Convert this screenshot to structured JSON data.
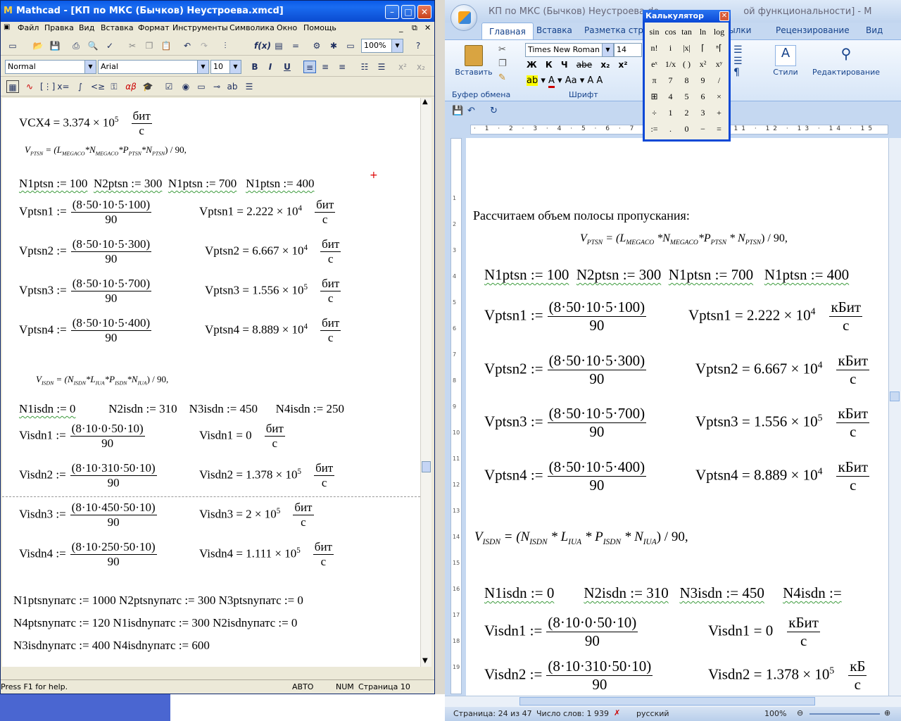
{
  "word": {
    "title": "КП по МКС (Бычков) Неустроева.do",
    "title_suffix": "ой функциональности] - M",
    "tabs": [
      "Главная",
      "Вставка",
      "Разметка стран",
      "ссылки",
      "Рецензирование",
      "Вид"
    ],
    "ribbon": {
      "paste": "Вставить",
      "clipboard_group": "Буфер обмена",
      "font_name": "Times New Roman",
      "font_size": "14",
      "font_group": "Шрифт",
      "styles": "Стили",
      "editing": "Редактирование",
      "format_buttons": [
        "Ж",
        "К",
        "Ч",
        "abe",
        "x₂",
        "x²",
        "Aa"
      ]
    },
    "ruler_marks": "· 1 · 2 · 3 · 4 · 5 · 6 · 7 · 8 · 9 · 10 · 11 · 12 · 13 · 14 · 15",
    "vruler_marks": [
      "1",
      "2",
      "3",
      "4",
      "5",
      "6",
      "7",
      "8",
      "9",
      "10",
      "11",
      "12",
      "13",
      "14",
      "15",
      "16",
      "17",
      "18",
      "19"
    ],
    "doc": {
      "intro": "Рассчитаем объем полосы пропускания:",
      "formula_ptsn": "= (L*N*P*N) / 90,",
      "formula_ptsn_parts": {
        "lhs": "V",
        "lhs_sub": "PTSN",
        "a": "L",
        "a_sub": "MEGACO",
        "b": "N",
        "b_sub": "MEGACO",
        "c": "P",
        "c_sub": "PTSN",
        "d": "N",
        "d_sub": "PTSN",
        "tail": ") / 90,"
      },
      "assign_ptsn": [
        "N1ptsn := 100",
        "N2ptsn := 300",
        "N1ptsn := 700",
        "N1ptsn := 400"
      ],
      "rows_ptsn": [
        {
          "lhs": "Vptsn1 :=",
          "num": "(8·50·10·5·100)",
          "den": "90",
          "res": "Vptsn1 = 2.222 × 10",
          "exp": "4",
          "unit_n": "кБит",
          "unit_d": "с"
        },
        {
          "lhs": "Vptsn2 :=",
          "num": "(8·50·10·5·300)",
          "den": "90",
          "res": "Vptsn2 = 6.667 × 10",
          "exp": "4",
          "unit_n": "кБит",
          "unit_d": "с"
        },
        {
          "lhs": "Vptsn3 :=",
          "num": "(8·50·10·5·700)",
          "den": "90",
          "res": "Vptsn3 = 1.556 × 10",
          "exp": "5",
          "unit_n": "кБит",
          "unit_d": "с"
        },
        {
          "lhs": "Vptsn4 :=",
          "num": "(8·50·10·5·400)",
          "den": "90",
          "res": "Vptsn4 = 8.889 × 10",
          "exp": "4",
          "unit_n": "кБит",
          "unit_d": "с"
        }
      ],
      "formula_isdn": {
        "lhs": "V",
        "lhs_sub": "ISDN",
        "a": "N",
        "a_sub": "ISDN",
        "b": "L",
        "b_sub": "IUA",
        "c": "P",
        "c_sub": "ISDN",
        "d": "N",
        "d_sub": "IUA",
        "tail": ") / 90,"
      },
      "assign_isdn": [
        "N1isdn := 0",
        "N2isdn := 310",
        "N3isdn := 450",
        "N4isdn :="
      ],
      "rows_isdn": [
        {
          "lhs": "Visdn1 :=",
          "num": "(8·10·0·50·10)",
          "den": "90",
          "res": "Visdn1 = 0",
          "exp": "",
          "unit_n": "кБит",
          "unit_d": "с"
        },
        {
          "lhs": "Visdn2 :=",
          "num": "(8·10·310·50·10)",
          "den": "90",
          "res": "Visdn2 = 1.378 × 10",
          "exp": "5",
          "unit_n": "кБ",
          "unit_d": "с"
        }
      ]
    },
    "status": {
      "page": "Страница: 24 из 47",
      "words": "Число слов: 1 939",
      "lang": "русский",
      "zoom": "100%"
    }
  },
  "calculator": {
    "title": "Калькулятор",
    "keys": [
      "sin",
      "cos",
      "tan",
      "ln",
      "log",
      "n!",
      "i",
      "|x|",
      "⌈",
      "ⁿ⌈",
      "eˣ",
      "1/x",
      "( )",
      "x²",
      "xʸ",
      "π",
      "7",
      "8",
      "9",
      "/",
      "⊞",
      "4",
      "5",
      "6",
      "×",
      "÷",
      "1",
      "2",
      "3",
      "+",
      ":=",
      ".",
      "0",
      "−",
      "="
    ]
  },
  "mathcad": {
    "title": "Mathcad - [КП по МКС (Бычков) Неустроева.xmcd]",
    "menu": [
      "Файл",
      "Правка",
      "Вид",
      "Вставка",
      "Формат",
      "Инструменты",
      "Символика",
      "Окно",
      "Помощь"
    ],
    "zoom": "100%",
    "style": "Normal",
    "font": "Arial",
    "font_size": "10",
    "sheet": {
      "vcx4": {
        "lhs": "VCX4 = 3.374 × 10",
        "exp": "5",
        "unit_n": "бит",
        "unit_d": "с"
      },
      "formula_ptsn": {
        "lhs": "V",
        "lhs_sub": "PTSN",
        "a": "L",
        "a_sub": "MEGACO",
        "b": "N",
        "b_sub": "MEGACO",
        "c": "P",
        "c_sub": "PTSN",
        "d": "N",
        "d_sub": "PTSN",
        "tail": ") / 90,"
      },
      "assign_ptsn": [
        "N1ptsn := 100",
        "N2ptsn := 300",
        "N1ptsn := 700",
        "N1ptsn := 400"
      ],
      "rows_ptsn": [
        {
          "lhs": "Vptsn1 :=",
          "num": "(8·50·10·5·100)",
          "den": "90",
          "res": "Vptsn1 = 2.222 × 10",
          "exp": "4",
          "unit_n": "бит",
          "unit_d": "с"
        },
        {
          "lhs": "Vptsn2 :=",
          "num": "(8·50·10·5·300)",
          "den": "90",
          "res": "Vptsn2 = 6.667 × 10",
          "exp": "4",
          "unit_n": "бит",
          "unit_d": "с"
        },
        {
          "lhs": "Vptsn3 :=",
          "num": "(8·50·10·5·700)",
          "den": "90",
          "res": "Vptsn3 = 1.556 × 10",
          "exp": "5",
          "unit_n": "бит",
          "unit_d": "с"
        },
        {
          "lhs": "Vptsn4 :=",
          "num": "(8·50·10·5·400)",
          "den": "90",
          "res": "Vptsn4 = 8.889 × 10",
          "exp": "4",
          "unit_n": "бит",
          "unit_d": "с"
        }
      ],
      "formula_isdn": {
        "lhs": "V",
        "lhs_sub": "ISDN",
        "a": "N",
        "a_sub": "ISDN",
        "b": "L",
        "b_sub": "IUA",
        "c": "P",
        "c_sub": "ISDN",
        "d": "N",
        "d_sub": "IUA",
        "tail": ") / 90,"
      },
      "assign_isdn": [
        "N1isdn := 0",
        "N2isdn := 310",
        "N3isdn := 450",
        "N4isdn := 250"
      ],
      "rows_isdn": [
        {
          "lhs": "Visdn1 :=",
          "num": "(8·10·0·50·10)",
          "den": "90",
          "res": "Visdn1 = 0",
          "exp": "",
          "unit_n": "бит",
          "unit_d": "с"
        },
        {
          "lhs": "Visdn2 :=",
          "num": "(8·10·310·50·10)",
          "den": "90",
          "res": "Visdn2 = 1.378 × 10",
          "exp": "5",
          "unit_n": "бит",
          "unit_d": "с"
        },
        {
          "lhs": "Visdn3 :=",
          "num": "(8·10·450·50·10)",
          "den": "90",
          "res": "Visdn3 = 2 × 10",
          "exp": "5",
          "unit_n": "бит",
          "unit_d": "с"
        },
        {
          "lhs": "Visdn4 :=",
          "num": "(8·10·250·50·10)",
          "den": "90",
          "res": "Visdn4 = 1.111 × 10",
          "exp": "5",
          "unit_n": "бит",
          "unit_d": "с"
        }
      ],
      "assign_up": [
        "N1ptsnупатс := 1000  N2ptsnупатс := 300    N3ptsnупатс := 0",
        "N4ptsnупатс := 120   N1isdnупатс := 300   N2isdnупатс := 0",
        "N3isdnупатс := 400   N4isdnупатс := 600"
      ]
    },
    "status": {
      "help": "Press F1 for help.",
      "auto": "АВТО",
      "num": "NUM",
      "page": "Страница 10"
    }
  }
}
